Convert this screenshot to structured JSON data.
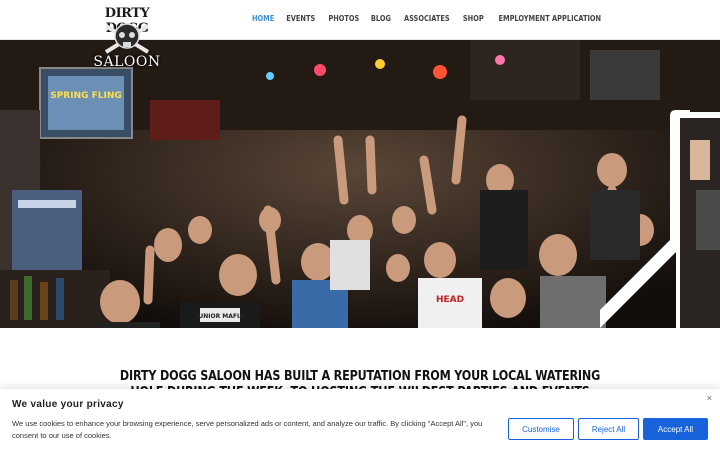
{
  "header": {
    "logo_top": "DIRTY DOGG",
    "logo_bottom": "SALOON",
    "nav": [
      {
        "label": "HOME",
        "active": true
      },
      {
        "label": "EVENTS"
      },
      {
        "label": "PHOTOS"
      },
      {
        "label": "BLOG"
      },
      {
        "label": "ASSOCIATES"
      },
      {
        "label": "SHOP"
      },
      {
        "label": "EMPLOYMENT APPLICATION"
      }
    ],
    "accent_color": "#3b8fd6"
  },
  "hero": {
    "sign_text": "SPRING FLING",
    "shirt_text": "JUNIOR MAFIA",
    "shirt_text_2": "HEAD"
  },
  "tagline": "DIRTY DOGG SALOON HAS BUILT A REPUTATION FROM YOUR LOCAL WATERING HOLE DURING THE WEEK, TO HOSTING THE WILDEST PARTIES AND EVENTS",
  "cookie": {
    "title": "We value your privacy",
    "text": "We use cookies to enhance your browsing experience, serve personalized ads or content, and analyze our traffic. By clicking \"Accept All\", you consent to our use of cookies.",
    "close_label": "×",
    "customise_label": "Customise",
    "reject_label": "Reject All",
    "accept_label": "Accept All",
    "button_color": "#1863dc"
  }
}
